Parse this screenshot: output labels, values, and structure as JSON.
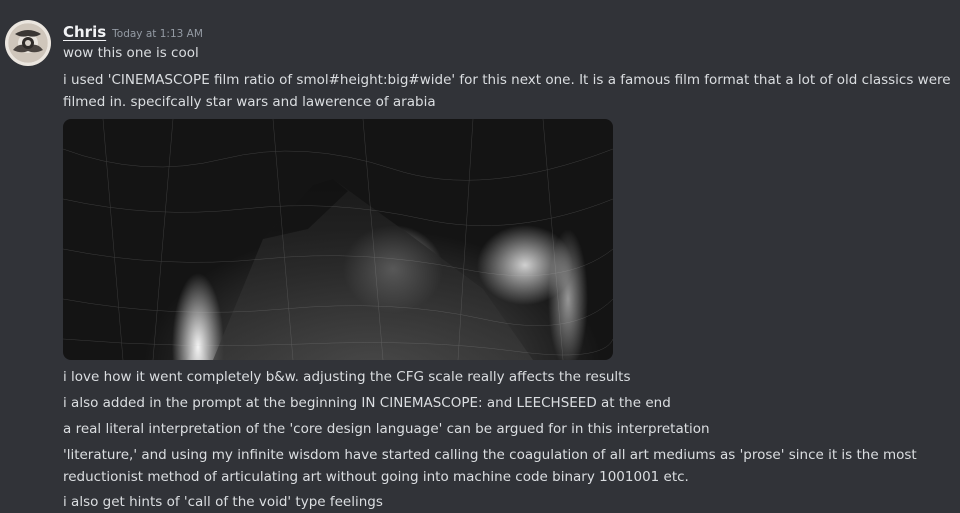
{
  "message": {
    "author": "Chris",
    "timestamp": "Today at 1:13 AM",
    "lines": [
      "wow this one is cool",
      "i used 'CINEMASCOPE film ratio of smol#height:big#wide' for this next one. It is a famous film format that a lot of old classics were filmed in. specifcally star wars and lawerence of arabia",
      "i love how it went completely b&w. adjusting the CFG scale really affects the results",
      "i also added in the prompt at the beginning IN CINEMASCOPE: and LEECHSEED at the end",
      "a real literal interpretation of the 'core design language' can be argued for in this interpretation",
      "'literature,' and using my infinite wisdom have started calling the coagulation of all art mediums as 'prose' since it is the most reductionist method of articulating art without going into machine code binary 1001001 etc.",
      "i also get hints of 'call of the void' type feelings"
    ]
  },
  "colors": {
    "background": "#313338",
    "text": "#dbdee1",
    "author": "#f2f3f5",
    "muted": "#949ba4"
  }
}
